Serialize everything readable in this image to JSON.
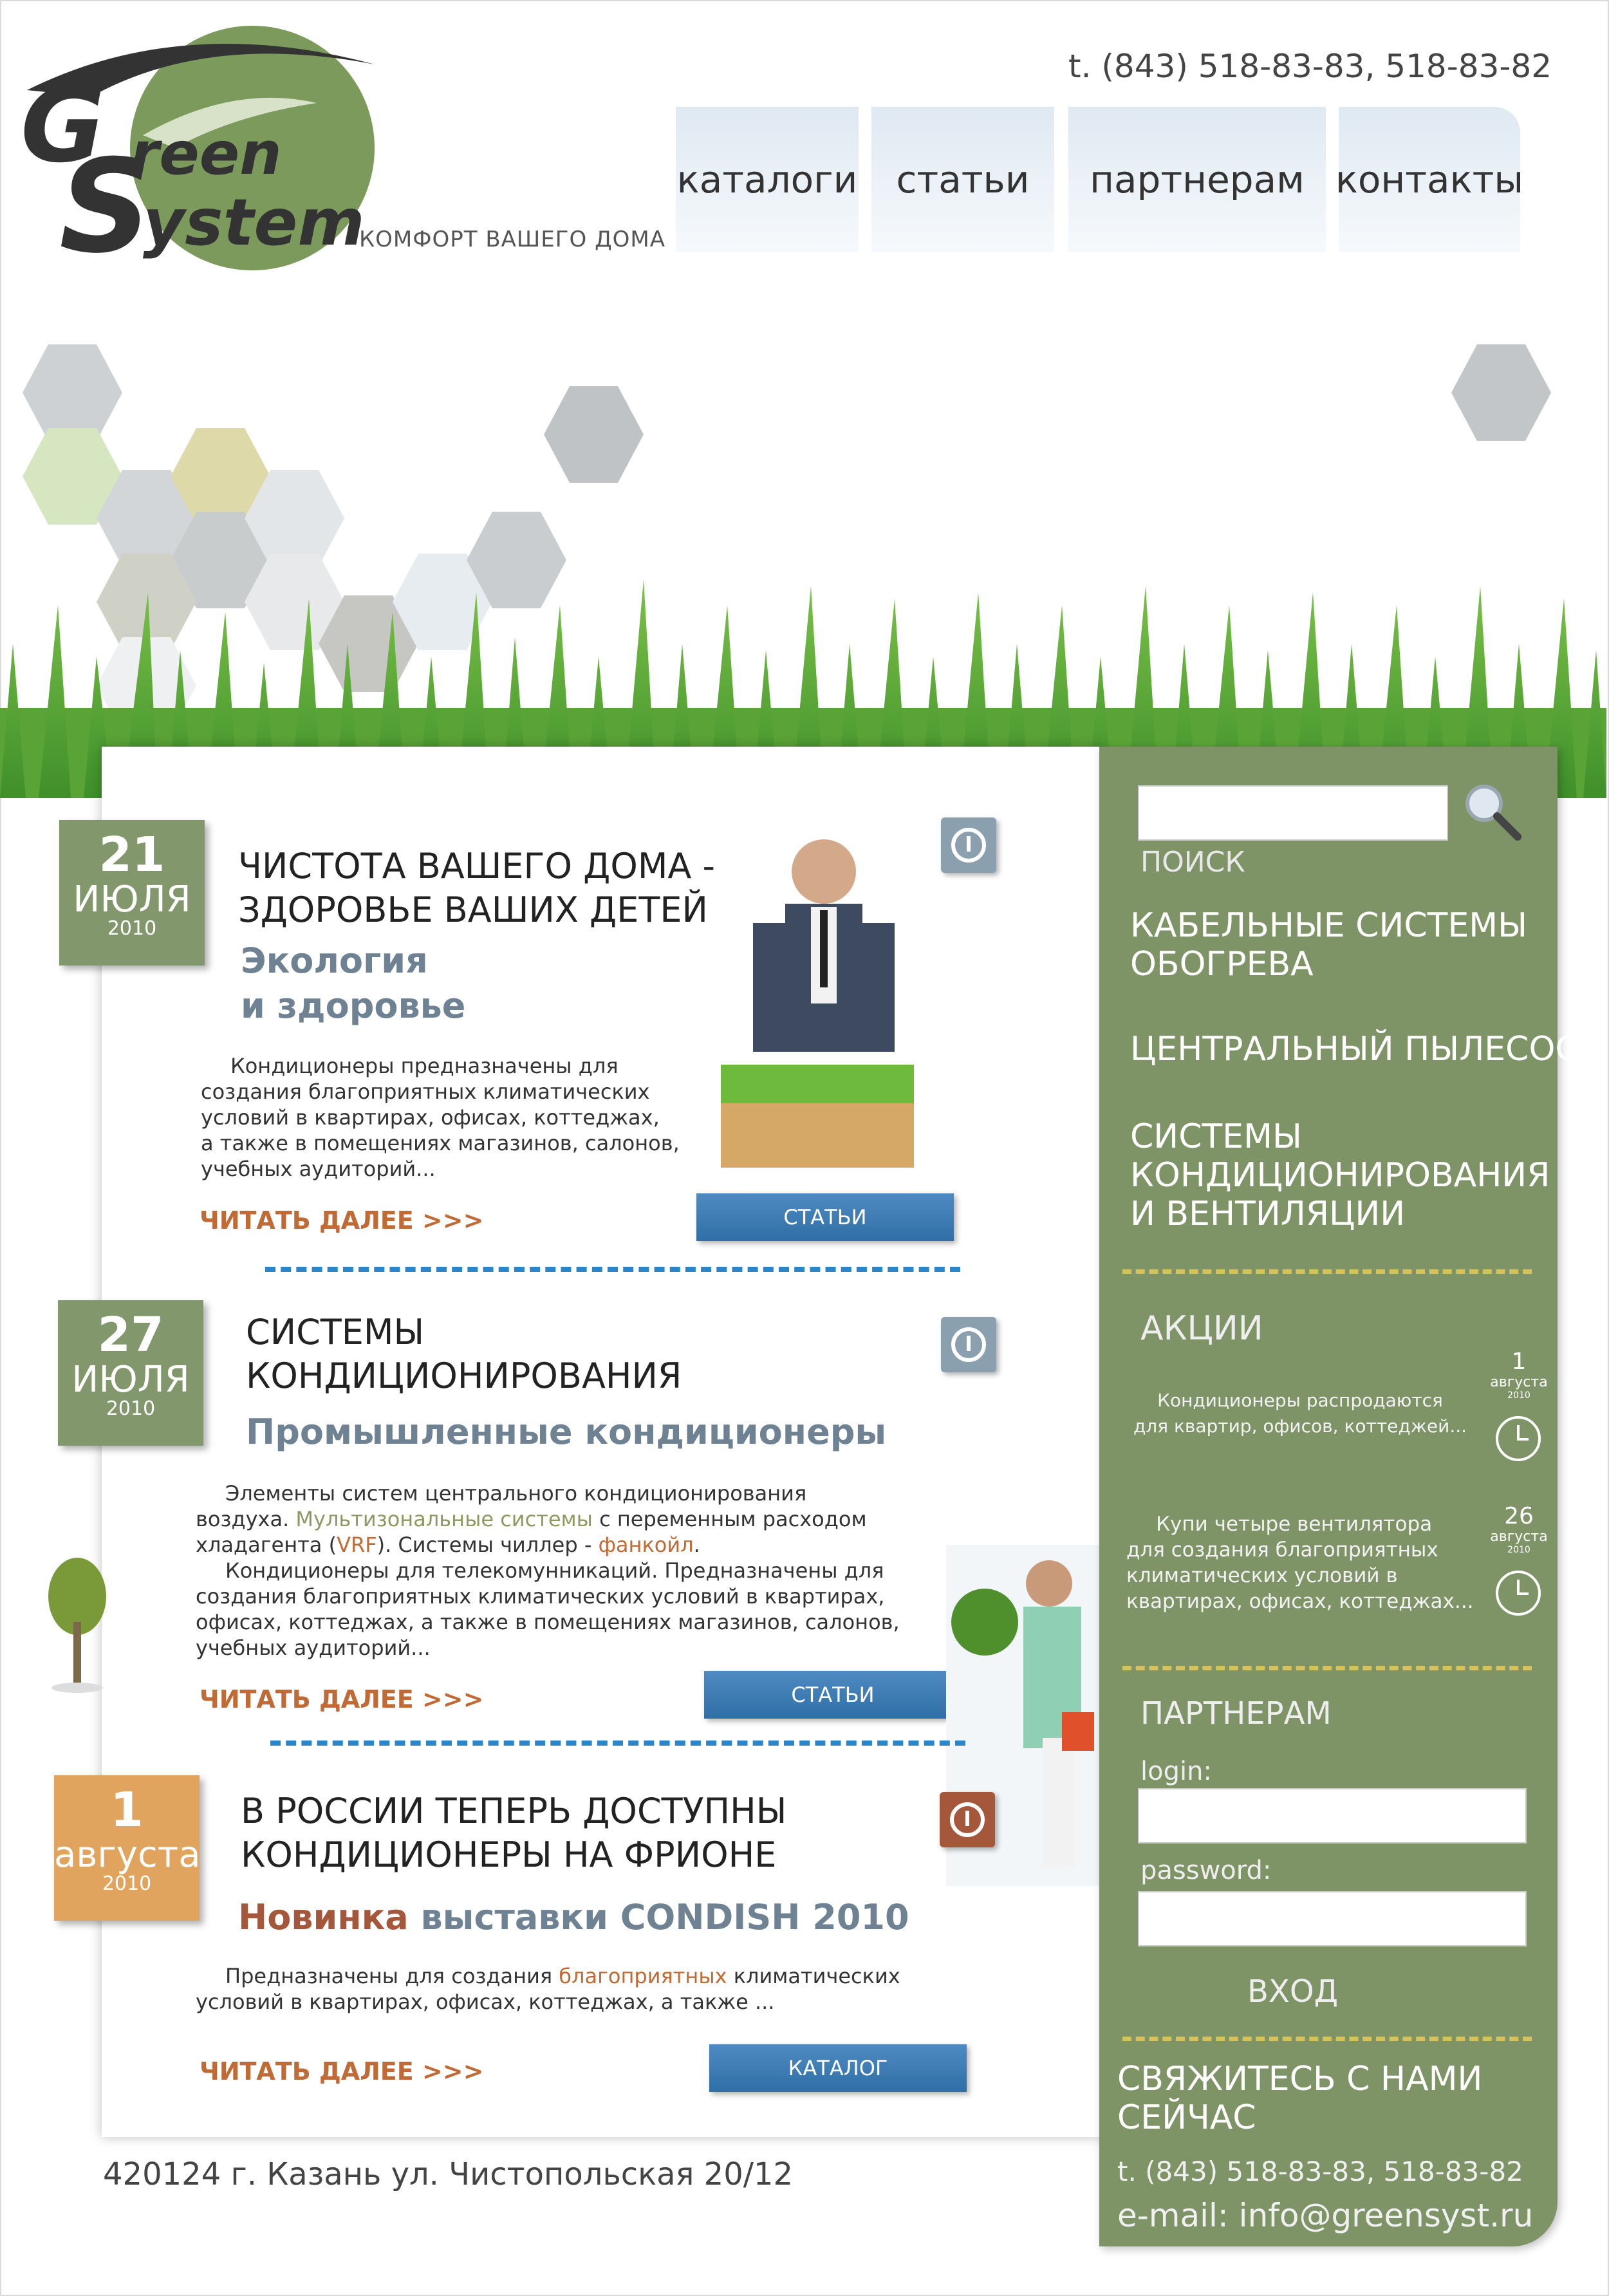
{
  "header": {
    "logo_line1": "Green",
    "logo_line2": "System",
    "tagline": "КОМФОРТ ВАШЕГО ДОМА",
    "phone": "t. (843) 518-83-83,  518-83-82"
  },
  "nav": {
    "items": [
      "каталоги",
      "статьи",
      "партнерам",
      "контакты"
    ]
  },
  "articles": [
    {
      "day": "21",
      "month": "ИЮЛЯ",
      "year": "2010",
      "title1": "ЧИСТОТА ВАШЕГО ДОМА -",
      "title2": "ЗДОРОВЬЕ ВАШИХ ДЕТЕЙ",
      "sub1": "Экология",
      "sub2": "и здоровье",
      "text": [
        "Кондиционеры предназначены для",
        "создания благоприятных климатических",
        "условий в квартирах, офисах, коттеджах,",
        "а также в помещениях магазинов, салонов,",
        "учебных аудиторий..."
      ],
      "more": "ЧИТАТЬ ДАЛЕЕ >>>",
      "button": "СТАТЬИ"
    },
    {
      "day": "27",
      "month": "ИЮЛЯ",
      "year": "2010",
      "title1": "СИСТЕМЫ",
      "title2": "КОНДИЦИОНИРОВАНИЯ",
      "sub1": "Промышленные кондиционеры",
      "text_l1": "Элементы систем центрального кондиционирования",
      "text_l2a": "воздуха. ",
      "text_l2b": "Мультизональные системы",
      "text_l2c": " с переменным расходом",
      "text_l3a": "хладагента (",
      "text_l3b": "VRF",
      "text_l3c": "). Системы чиллер - ",
      "text_l3d": "фанкойл",
      "text_l3e": ".",
      "text_l4": "Кондиционеры для телекомунникаций. Предназначены для",
      "text_l5": "создания благоприятных климатических условий в квартирах,",
      "text_l6": "офисах, коттеджах, а также в помещениях магазинов, салонов,",
      "text_l7": "учебных аудиторий...",
      "more": "ЧИТАТЬ ДАЛЕЕ >>>",
      "button": "СТАТЬИ"
    },
    {
      "day": "1",
      "month": "августа",
      "year": "2010",
      "title1": "В РОССИИ ТЕПЕРЬ ДОСТУПНЫ",
      "title2": "КОНДИЦИОНЕРЫ НА ФРИОНЕ",
      "sub_a": "Новинка",
      "sub_b": " выставки CONDISH 2010",
      "text_l1a": "Предназначены для создания ",
      "text_l1b": "благоприятных",
      "text_l1c": " климатических",
      "text_l2": "условий в квартирах, офисах, коттеджах, а также ...",
      "more": "ЧИТАТЬ ДАЛЕЕ >>>",
      "button": "КАТАЛОГ"
    }
  ],
  "sidebar": {
    "search_label": "ПОИСК",
    "links": [
      [
        "КАБЕЛЬНЫЕ СИСТЕМЫ",
        "ОБОГРЕВА"
      ],
      [
        "ЦЕНТРАЛЬНЫЙ ПЫЛЕСОС"
      ],
      [
        "СИСТЕМЫ",
        "КОНДИЦИОНИРОВАНИЯ",
        "И ВЕНТИЛЯЦИИ"
      ]
    ],
    "promo_title": "АКЦИИ",
    "promos": [
      {
        "lines": [
          "Кондиционеры распродаются",
          "для квартир, офисов, коттеджей..."
        ],
        "day": "1",
        "month": "августа",
        "year": "2010"
      },
      {
        "lines": [
          "Купи четыре вентилятора",
          "для создания благоприятных",
          "климатических условий в",
          "квартирах, офисах, коттеджах..."
        ],
        "day": "26",
        "month": "августа",
        "year": "2010"
      }
    ],
    "partners_title": "ПАРТНЕРАМ",
    "login_label": "login:",
    "password_label": "password:",
    "login_button": "ВХОД",
    "contact_title1": "СВЯЖИТЕСЬ С НАМИ",
    "contact_title2": "СЕЙЧАС",
    "contact_phone": "t. (843) 518-83-83,  518-83-82",
    "contact_email": "e-mail: info@greensyst.ru"
  },
  "footer": {
    "address": "420124   г. Казань ул. Чистопольская 20/12"
  },
  "colors": {
    "sidebar": "#7f9466",
    "accent_orange": "#c06a35",
    "button_blue": "#3a78b0",
    "date_green": "#82976b",
    "date_orange": "#e0a45e"
  }
}
